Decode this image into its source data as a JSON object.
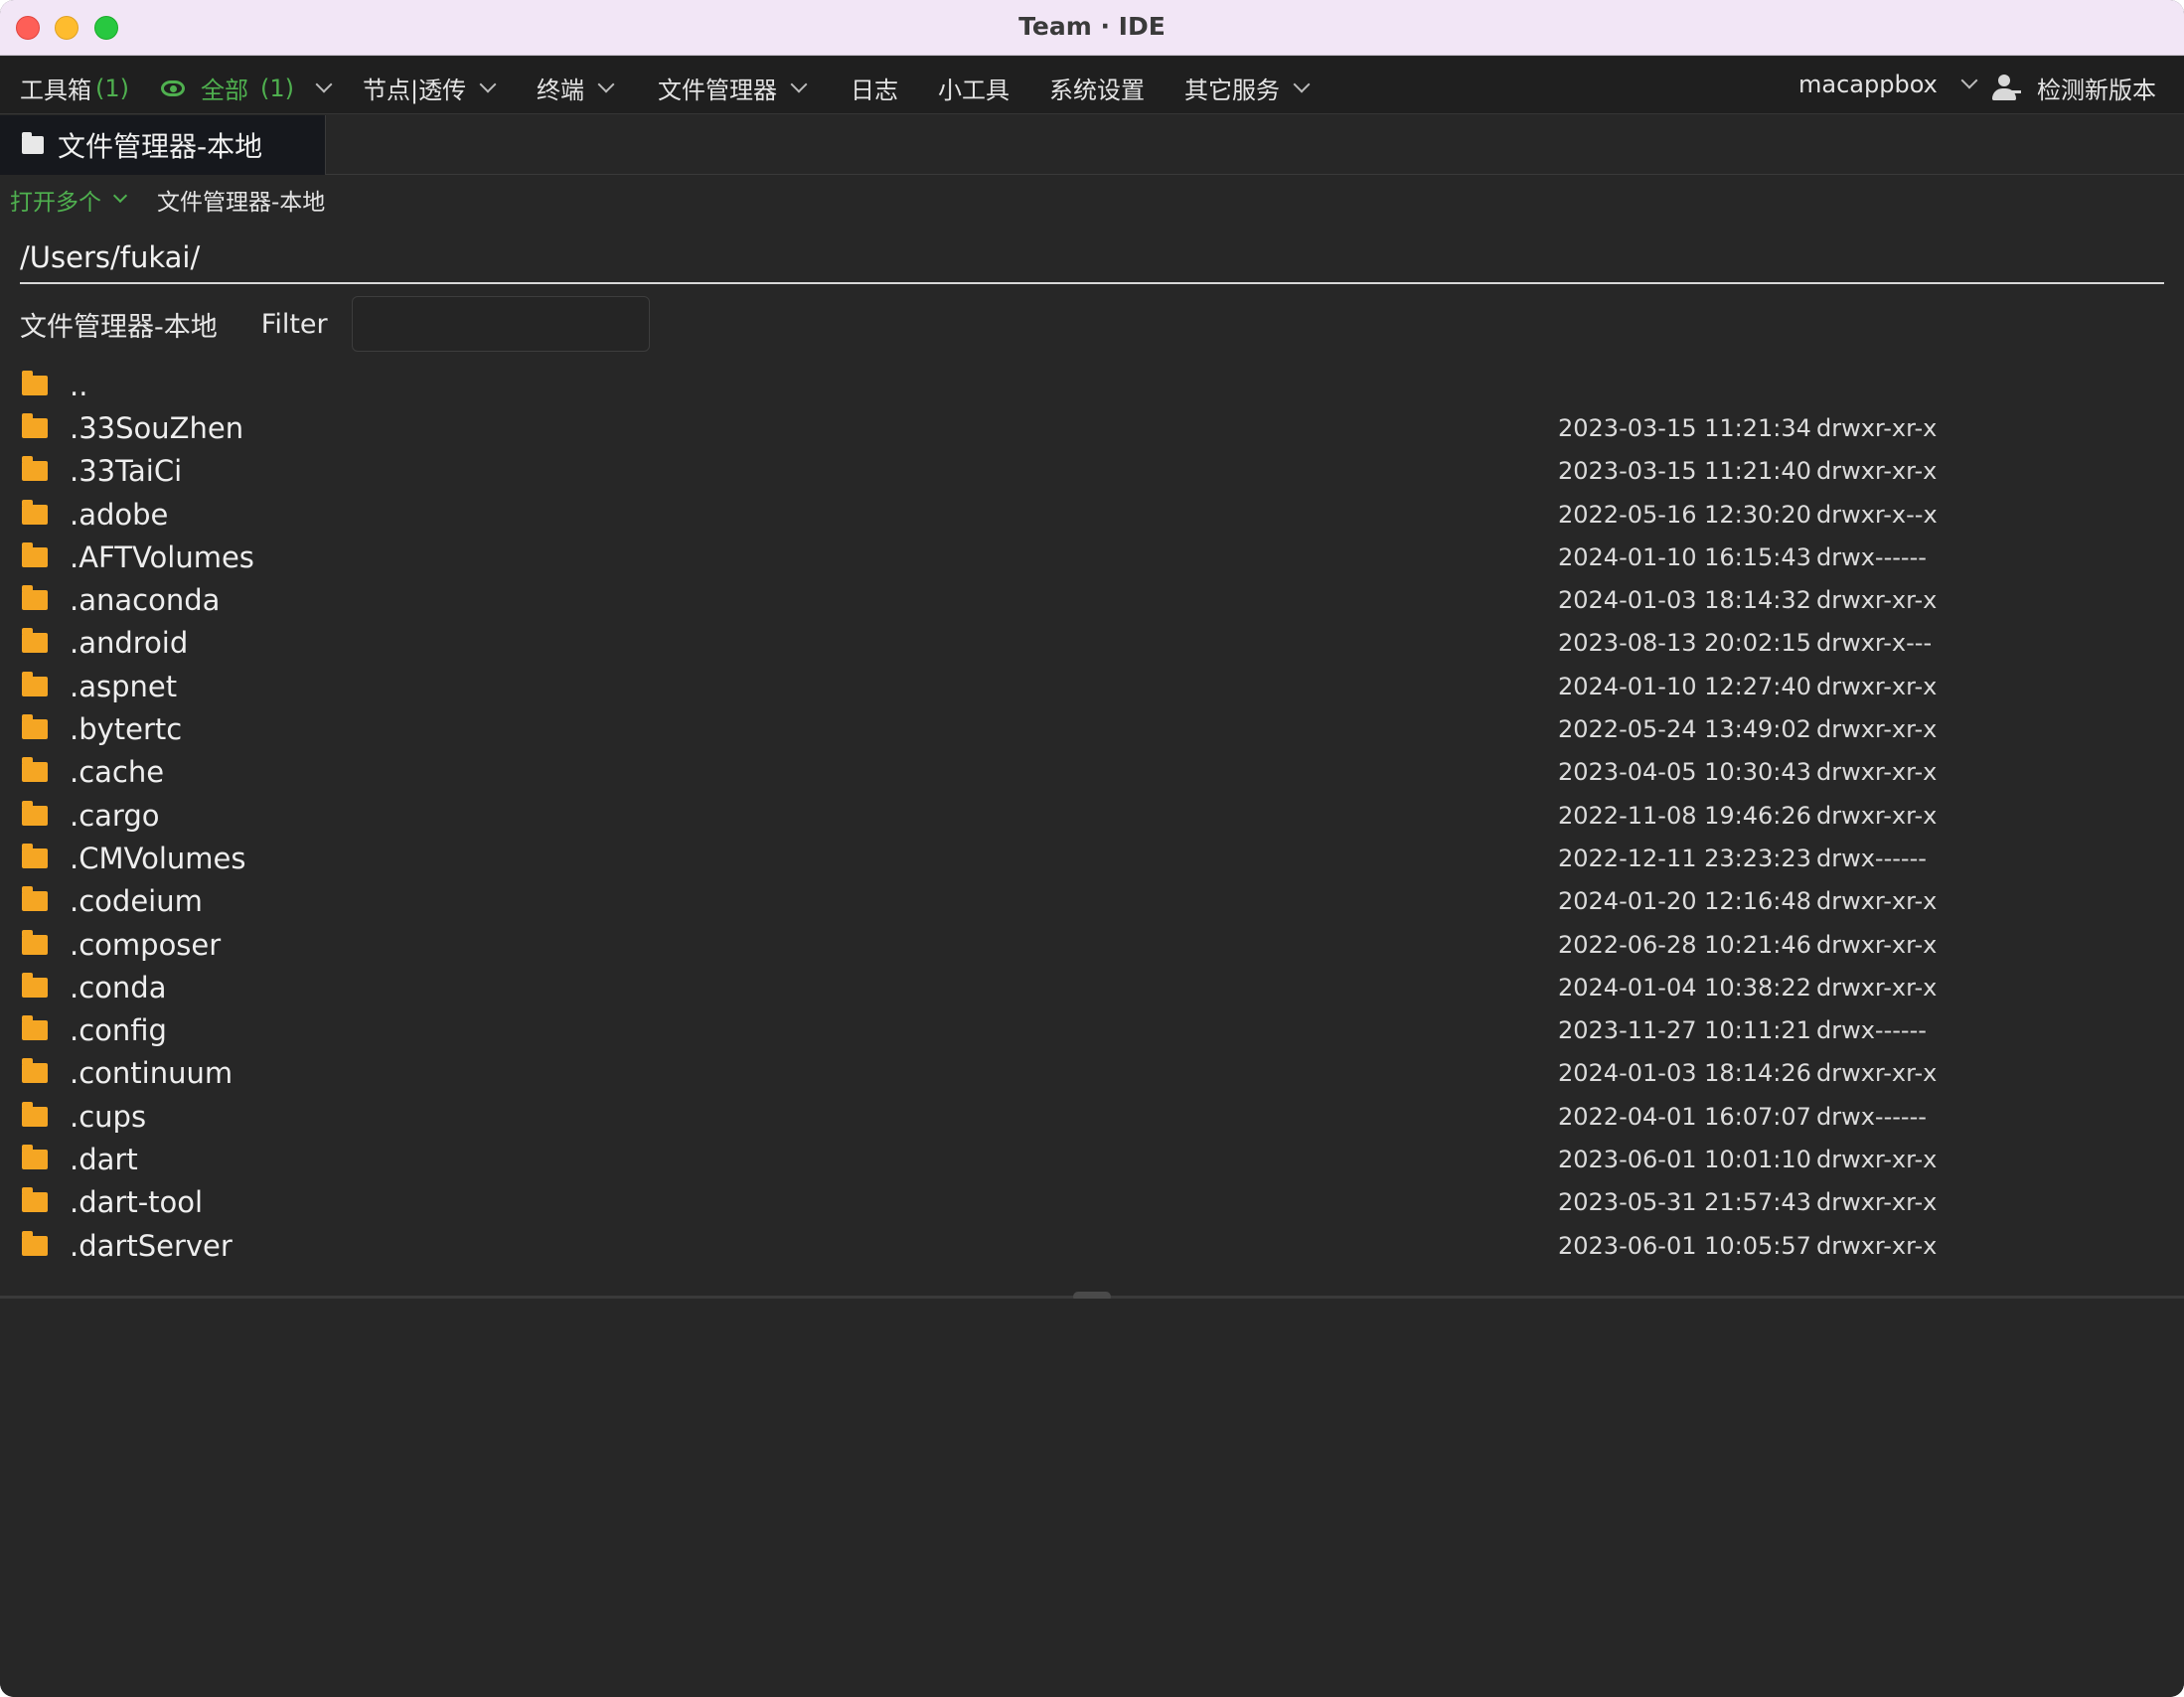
{
  "window": {
    "title": "Team · IDE"
  },
  "menubar": {
    "toolbox_label": "工具箱",
    "toolbox_count": "(1)",
    "all_label": "全部",
    "all_count": "(1)",
    "nodes_label": "节点|透传",
    "terminal_label": "终端",
    "file_manager_label": "文件管理器",
    "logs_label": "日志",
    "tools_label": "小工具",
    "settings_label": "系统设置",
    "other_services_label": "其它服务",
    "account_label": "macappbox",
    "check_update_label": "检测新版本"
  },
  "tab": {
    "label": "文件管理器-本地"
  },
  "subbar": {
    "open_many_label": "打开多个",
    "crumb": "文件管理器-本地"
  },
  "path": "/Users/fukai/",
  "filter": {
    "source_label": "文件管理器-本地",
    "filter_label": "Filter",
    "value": "",
    "placeholder": ""
  },
  "files": [
    {
      "name": "..",
      "date": "",
      "perm": ""
    },
    {
      "name": ".33SouZhen",
      "date": "2023-03-15 11:21:34",
      "perm": "drwxr-xr-x"
    },
    {
      "name": ".33TaiCi",
      "date": "2023-03-15 11:21:40",
      "perm": "drwxr-xr-x"
    },
    {
      "name": ".adobe",
      "date": "2022-05-16 12:30:20",
      "perm": "drwxr-x--x"
    },
    {
      "name": ".AFTVolumes",
      "date": "2024-01-10 16:15:43",
      "perm": "drwx------"
    },
    {
      "name": ".anaconda",
      "date": "2024-01-03 18:14:32",
      "perm": "drwxr-xr-x"
    },
    {
      "name": ".android",
      "date": "2023-08-13 20:02:15",
      "perm": "drwxr-x---"
    },
    {
      "name": ".aspnet",
      "date": "2024-01-10 12:27:40",
      "perm": "drwxr-xr-x"
    },
    {
      "name": ".bytertc",
      "date": "2022-05-24 13:49:02",
      "perm": "drwxr-xr-x"
    },
    {
      "name": ".cache",
      "date": "2023-04-05 10:30:43",
      "perm": "drwxr-xr-x"
    },
    {
      "name": ".cargo",
      "date": "2022-11-08 19:46:26",
      "perm": "drwxr-xr-x"
    },
    {
      "name": ".CMVolumes",
      "date": "2022-12-11 23:23:23",
      "perm": "drwx------"
    },
    {
      "name": ".codeium",
      "date": "2024-01-20 12:16:48",
      "perm": "drwxr-xr-x"
    },
    {
      "name": ".composer",
      "date": "2022-06-28 10:21:46",
      "perm": "drwxr-xr-x"
    },
    {
      "name": ".conda",
      "date": "2024-01-04 10:38:22",
      "perm": "drwxr-xr-x"
    },
    {
      "name": ".config",
      "date": "2023-11-27 10:11:21",
      "perm": "drwx------"
    },
    {
      "name": ".continuum",
      "date": "2024-01-03 18:14:26",
      "perm": "drwxr-xr-x"
    },
    {
      "name": ".cups",
      "date": "2022-04-01 16:07:07",
      "perm": "drwx------"
    },
    {
      "name": ".dart",
      "date": "2023-06-01 10:01:10",
      "perm": "drwxr-xr-x"
    },
    {
      "name": ".dart-tool",
      "date": "2023-05-31 21:57:43",
      "perm": "drwxr-xr-x"
    },
    {
      "name": ".dartServer",
      "date": "2023-06-01 10:05:57",
      "perm": "drwxr-xr-x"
    }
  ],
  "colors": {
    "accent": "#4fb04f",
    "folder": "#f5a623",
    "background": "#272727"
  }
}
